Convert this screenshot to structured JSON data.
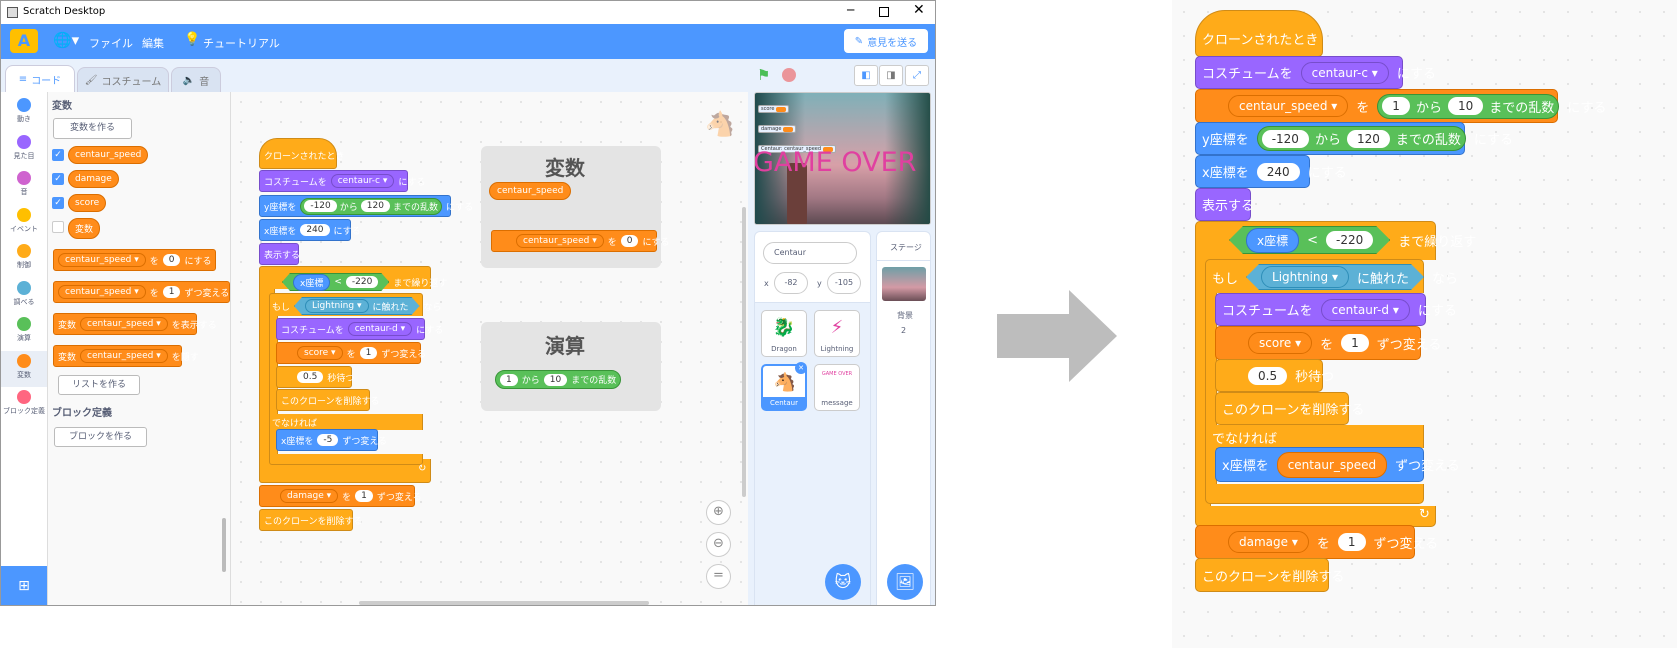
{
  "window": {
    "title": "Scratch Desktop"
  },
  "menu": {
    "file": "ファイル",
    "edit": "編集",
    "tutorial": "チュートリアル",
    "feedback": "意見を送る"
  },
  "tabs": {
    "code": "コード",
    "costume": "コスチューム",
    "sound": "音"
  },
  "categories": [
    {
      "label": "動き",
      "color": "#4c97ff"
    },
    {
      "label": "見た目",
      "color": "#9966ff"
    },
    {
      "label": "音",
      "color": "#cf63cf"
    },
    {
      "label": "イベント",
      "color": "#ffbf00"
    },
    {
      "label": "制御",
      "color": "#ffab19"
    },
    {
      "label": "調べる",
      "color": "#5cb1d6"
    },
    {
      "label": "演算",
      "color": "#59c059"
    },
    {
      "label": "変数",
      "color": "#ff8c1a"
    },
    {
      "label": "ブロック定義",
      "color": "#ff6680"
    }
  ],
  "palette": {
    "heading": "変数",
    "make_var": "変数を作る",
    "vars": [
      "centaur_speed",
      "damage",
      "score",
      "変数"
    ],
    "set_to": "を",
    "set_value": "0",
    "set_suffix": "にする",
    "change_value": "1",
    "change_suffix": "ずつ変える",
    "var_prefix": "変数",
    "show_suffix": "を表示する",
    "hide_suffix": "を隠す",
    "make_list": "リストを作る",
    "blocks_heading": "ブロック定義",
    "make_block": "ブロックを作る",
    "var_dd": "centaur_speed"
  },
  "script": {
    "hat": "クローンされたとき",
    "costume_prefix": "コスチュームを",
    "costume_c": "centaur-c",
    "costume_d": "centaur-d",
    "set_suffix": "にする",
    "var_speed": "centaur_speed",
    "to": "を",
    "from": "から",
    "random_suffix": "までの乱数",
    "rand1_from": "1",
    "rand1_to": "10",
    "y_prefix": "y座標を",
    "rand2_from": "-120",
    "rand2_to": "120",
    "x_prefix": "x座標を",
    "x_value": "240",
    "show": "表示する",
    "x_reporter": "x座標",
    "lt": "<",
    "lt_value": "-220",
    "repeat_until": "まで繰り返す",
    "if": "もし",
    "lightning": "Lightning",
    "touching": "に触れた",
    "then": "なら",
    "score": "score",
    "one": "1",
    "change_suffix": "ずつ変える",
    "wait_value": "0.5",
    "wait_suffix": "秒待つ",
    "delete_clone": "このクローンを削除する",
    "else": "でなければ",
    "x_change_prefix": "x座標を",
    "x_change_value": "-5",
    "damage": "damage"
  },
  "ws_cards": {
    "var_title": "変数",
    "var_reporter": "centaur_speed",
    "op_title": "演算"
  },
  "stage": {
    "game_over": "GAME OVER",
    "monitors": [
      "score",
      "damage",
      "Centaur: centaur_speed"
    ]
  },
  "sprite_info": {
    "name": "Centaur",
    "x_label": "x",
    "x": "-82",
    "y_label": "y",
    "y": "-105"
  },
  "sprites": [
    {
      "name": "Dragon"
    },
    {
      "name": "Lightning"
    },
    {
      "name": "Centaur"
    },
    {
      "name": "message",
      "thumb": "GAME OVER"
    }
  ],
  "stage_panel": {
    "label": "ステージ",
    "backdrops_label": "背景",
    "backdrops": "2"
  }
}
